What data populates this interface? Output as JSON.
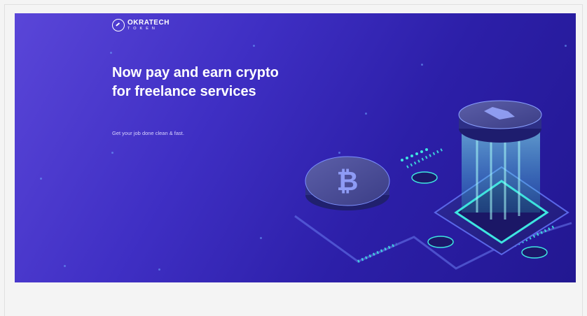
{
  "brand": {
    "name": "OKRATECH",
    "sub": "TOKEN"
  },
  "hero": {
    "headline": "Now pay and earn crypto for freelance services",
    "subtext": "Get your job done clean & fast."
  },
  "colors": {
    "accent": "#4a3ad0",
    "cyan": "#3ee6e0",
    "background": "#f4f4f4"
  },
  "icons": [
    "logo-icon",
    "bitcoin-coin-icon",
    "token-coin-icon"
  ]
}
